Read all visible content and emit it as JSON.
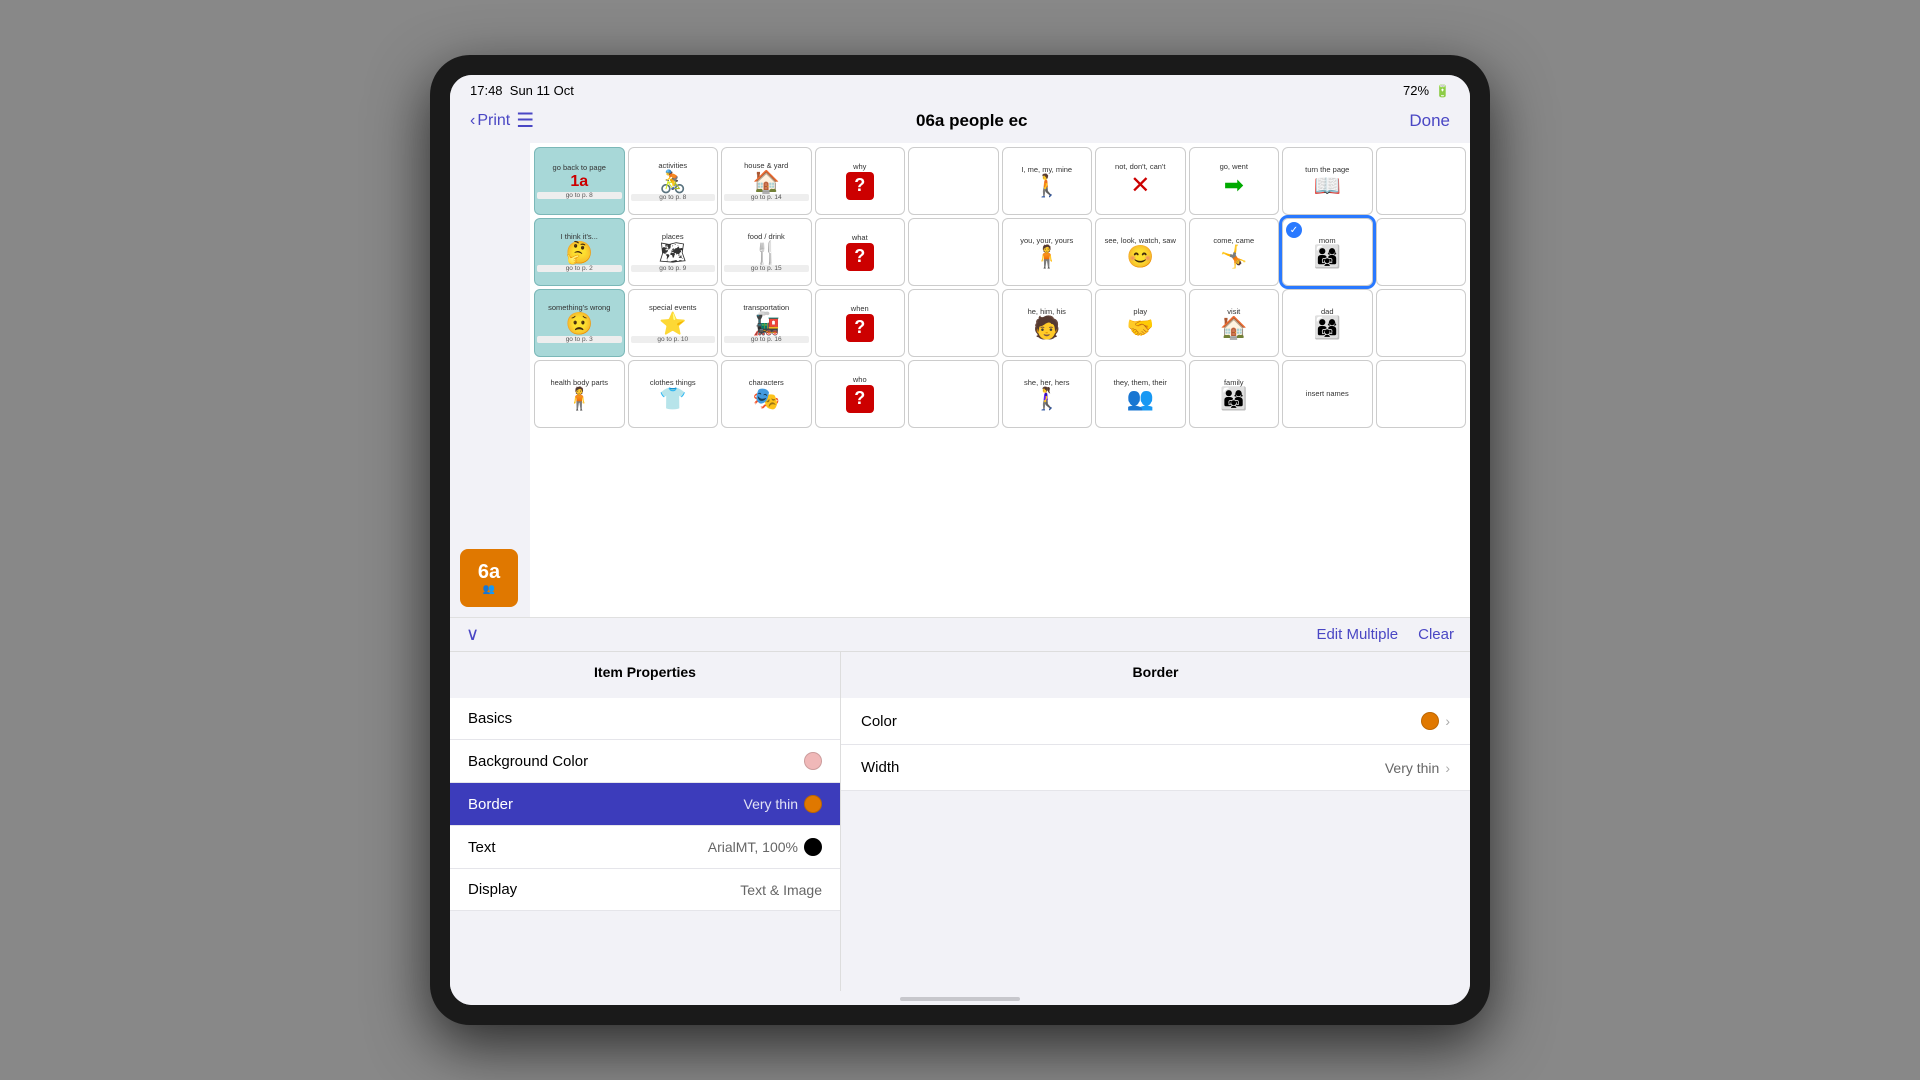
{
  "status": {
    "time": "17:48",
    "date": "Sun 11 Oct",
    "battery": "72%"
  },
  "nav": {
    "back_label": "Print",
    "title": "06a people ec",
    "done_label": "Done"
  },
  "toolbar": {
    "edit_multiple": "Edit Multiple",
    "clear": "Clear"
  },
  "item_properties": {
    "title": "Item Properties",
    "items": [
      {
        "label": "Basics",
        "value": "",
        "color": null
      },
      {
        "label": "Background Color",
        "value": "",
        "color": "#f0b8b8",
        "color_hint": "light-pink"
      },
      {
        "label": "Border",
        "value": "Very thin",
        "color": "#e07800",
        "active": true
      },
      {
        "label": "Text",
        "value": "ArialMT, 100%",
        "color": "#000000"
      },
      {
        "label": "Display",
        "value": "Text & Image",
        "color": null
      }
    ]
  },
  "border_panel": {
    "title": "Border",
    "items": [
      {
        "label": "Color",
        "value": "",
        "color": "#e07800"
      },
      {
        "label": "Width",
        "value": "Very thin"
      }
    ]
  },
  "grid": {
    "cells": [
      {
        "label": "go back to page",
        "sublabel": "1a",
        "goto": "go to p. 8",
        "icon": "🔄",
        "bg": "teal"
      },
      {
        "label": "activities",
        "goto": "go to p. 8",
        "icon": "🚴",
        "bg": ""
      },
      {
        "label": "house & yard",
        "goto": "go to p. 14",
        "icon": "🏠",
        "bg": ""
      },
      {
        "label": "why",
        "icon": "❓",
        "bg": "question"
      },
      {
        "label": "",
        "icon": "",
        "bg": ""
      },
      {
        "label": "I, me, my, mine",
        "icon": "🚶",
        "bg": ""
      },
      {
        "label": "not, don't, can't",
        "icon": "✗",
        "bg": ""
      },
      {
        "label": "go, went",
        "icon": "→",
        "bg": ""
      },
      {
        "label": "turn the page",
        "icon": "📖",
        "bg": ""
      },
      {
        "label": "",
        "icon": "",
        "bg": ""
      },
      {
        "label": "I think it's...",
        "goto": "go to p. 2",
        "icon": "🤔",
        "bg": "teal"
      },
      {
        "label": "places",
        "goto": "go to p. 9",
        "icon": "💵",
        "bg": ""
      },
      {
        "label": "food / drink",
        "goto": "go to p. 15",
        "icon": "🍴",
        "bg": ""
      },
      {
        "label": "what",
        "icon": "❓",
        "bg": "question"
      },
      {
        "label": "",
        "icon": "",
        "bg": ""
      },
      {
        "label": "you, your, yours",
        "icon": "🚶🚶",
        "bg": ""
      },
      {
        "label": "see, look, watch, saw",
        "icon": "😊",
        "bg": ""
      },
      {
        "label": "come, came",
        "icon": "👋",
        "bg": ""
      },
      {
        "label": "mom",
        "icon": "👨‍👩‍👧",
        "bg": "selected"
      },
      {
        "label": "",
        "icon": "",
        "bg": ""
      },
      {
        "label": "something's wrong",
        "goto": "go to p. 3",
        "icon": "😟",
        "bg": "teal"
      },
      {
        "label": "special events",
        "goto": "go to p. 10",
        "icon": "⭐",
        "bg": ""
      },
      {
        "label": "transportation",
        "goto": "go to p. 16",
        "icon": "🚂",
        "bg": ""
      },
      {
        "label": "when",
        "icon": "❓",
        "bg": "question"
      },
      {
        "label": "",
        "icon": "",
        "bg": ""
      },
      {
        "label": "he, him, his",
        "icon": "🧑",
        "bg": ""
      },
      {
        "label": "play",
        "icon": "🤝",
        "bg": ""
      },
      {
        "label": "visit",
        "icon": "🏠",
        "bg": ""
      },
      {
        "label": "dad",
        "icon": "👨‍👩‍👧",
        "bg": ""
      },
      {
        "label": "",
        "icon": "",
        "bg": ""
      },
      {
        "label": "health body parts",
        "icon": "🧑",
        "bg": ""
      },
      {
        "label": "clothes things",
        "icon": "👗",
        "bg": ""
      },
      {
        "label": "characters",
        "icon": "🧑🎭",
        "bg": ""
      },
      {
        "label": "who",
        "icon": "❓",
        "bg": "question"
      },
      {
        "label": "",
        "icon": "",
        "bg": ""
      },
      {
        "label": "she, her, hers",
        "icon": "🚶‍♀️",
        "bg": ""
      },
      {
        "label": "they, them, their",
        "icon": "👤",
        "bg": ""
      },
      {
        "label": "family",
        "icon": "👨‍👩‍👧",
        "bg": ""
      },
      {
        "label": "insert names",
        "icon": "",
        "bg": ""
      },
      {
        "label": "",
        "icon": "",
        "bg": ""
      }
    ]
  }
}
